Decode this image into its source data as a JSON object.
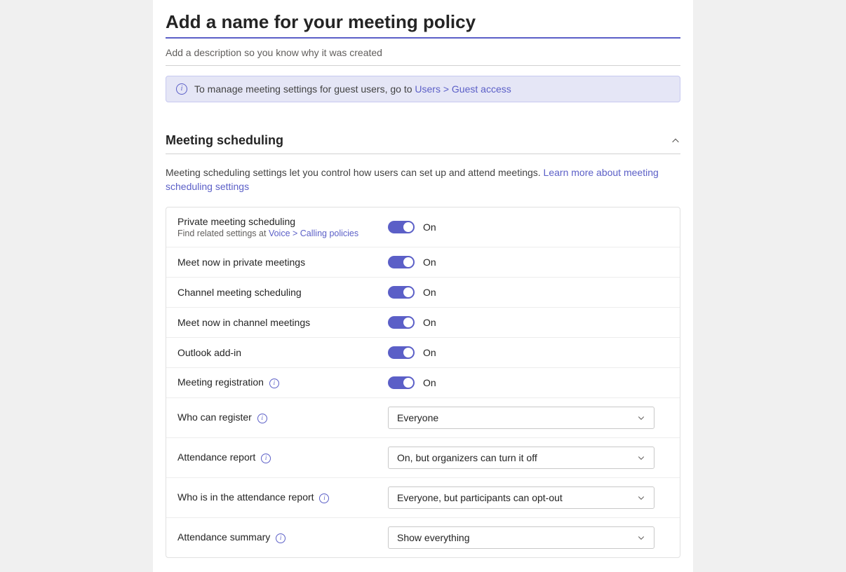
{
  "header": {
    "title_placeholder": "Add a name for your meeting policy",
    "desc_placeholder": "Add a description so you know why it was created"
  },
  "banner": {
    "text_prefix": "To manage meeting settings for guest users, go to ",
    "link_text": "Users > Guest access"
  },
  "section": {
    "title": "Meeting scheduling",
    "desc_prefix": "Meeting scheduling settings let you control how users can set up and attend meetings. ",
    "desc_link": "Learn more about meeting scheduling settings"
  },
  "rows": {
    "private_scheduling": {
      "label": "Private meeting scheduling",
      "sub_prefix": "Find related settings at ",
      "sub_link": "Voice > Calling policies",
      "state": "On"
    },
    "meet_now_private": {
      "label": "Meet now in private meetings",
      "state": "On"
    },
    "channel_scheduling": {
      "label": "Channel meeting scheduling",
      "state": "On"
    },
    "meet_now_channel": {
      "label": "Meet now in channel meetings",
      "state": "On"
    },
    "outlook_addin": {
      "label": "Outlook add-in",
      "state": "On"
    },
    "meeting_registration": {
      "label": "Meeting registration",
      "state": "On"
    },
    "who_can_register": {
      "label": "Who can register",
      "value": "Everyone"
    },
    "attendance_report": {
      "label": "Attendance report",
      "value": "On, but organizers can turn it off"
    },
    "who_in_report": {
      "label": "Who is in the attendance report",
      "value": "Everyone, but participants can opt-out"
    },
    "attendance_summary": {
      "label": "Attendance summary",
      "value": "Show everything"
    }
  }
}
